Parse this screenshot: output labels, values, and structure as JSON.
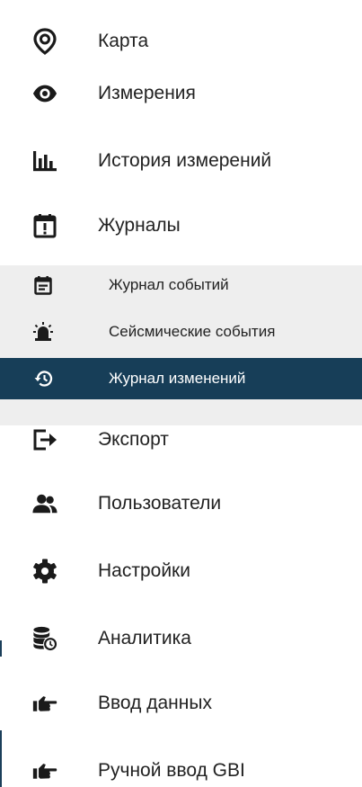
{
  "menu": {
    "items": [
      {
        "label": "Карта",
        "icon": "map-pin-icon"
      },
      {
        "label": "Измерения",
        "icon": "eye-icon"
      },
      {
        "label": "История измерений",
        "icon": "bar-chart-icon"
      },
      {
        "label": "Журналы",
        "icon": "calendar-alert-icon"
      },
      {
        "label": "Экспорт",
        "icon": "export-icon"
      },
      {
        "label": "Пользователи",
        "icon": "users-icon"
      },
      {
        "label": "Настройки",
        "icon": "gear-icon"
      },
      {
        "label": "Аналитика",
        "icon": "database-clock-icon"
      },
      {
        "label": "Ввод данных",
        "icon": "hand-point-icon"
      },
      {
        "label": "Ручной ввод GBI",
        "icon": "hand-point-icon"
      }
    ],
    "subitems": [
      {
        "label": "Журнал событий",
        "icon": "calendar-icon"
      },
      {
        "label": "Сейсмические события",
        "icon": "alarm-light-icon"
      },
      {
        "label": "Журнал изменений",
        "icon": "history-icon",
        "active": true
      }
    ]
  },
  "colors": {
    "active_bg": "#173e58",
    "submenu_bg": "#eeeeee",
    "icon": "#1a1a1a"
  }
}
